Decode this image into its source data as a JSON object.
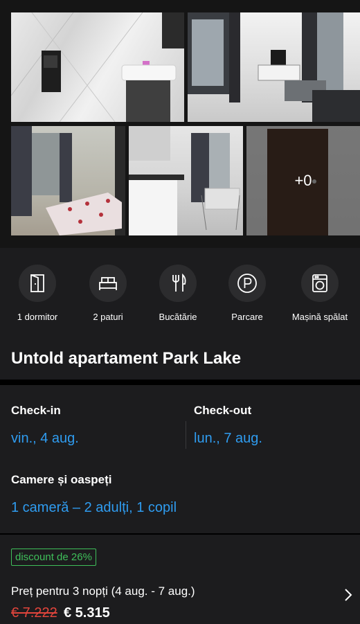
{
  "gallery": {
    "more_count": "+0"
  },
  "amenities": [
    {
      "icon": "door-icon",
      "label": "1 dormitor"
    },
    {
      "icon": "bed-icon",
      "label": "2 paturi"
    },
    {
      "icon": "fork-knife-icon",
      "label": "Bucătărie"
    },
    {
      "icon": "parking-icon",
      "label": "Parcare"
    },
    {
      "icon": "washing-machine-icon",
      "label": "Mașină spălat"
    }
  ],
  "title": "Untold apartament Park Lake",
  "booking": {
    "checkin_label": "Check-in",
    "checkin_value": "vin., 4 aug.",
    "checkout_label": "Check-out",
    "checkout_value": "lun., 7 aug.",
    "rooms_label": "Camere și oaspeți",
    "rooms_value": "1 cameră – 2 adulți, 1 copil"
  },
  "price": {
    "discount": "discount de 26%",
    "label": "Preț pentru 3 nopți (4 aug. - 7 aug.)",
    "old": "€ 7.222",
    "new": "€ 5.315"
  },
  "colors": {
    "accent_blue": "#2f9cf0",
    "discount_green": "#3fbf5a",
    "old_price_red": "#e2453c"
  }
}
